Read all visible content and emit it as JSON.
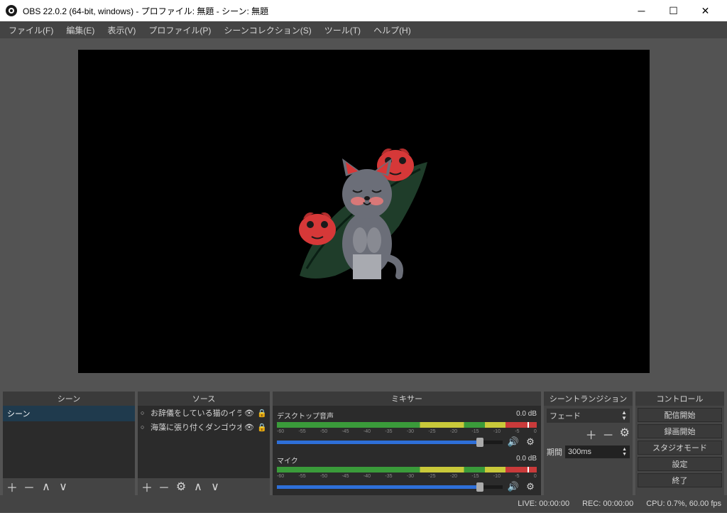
{
  "window": {
    "title": "OBS 22.0.2 (64-bit, windows) - プロファイル: 無題 - シーン: 無題"
  },
  "menu": {
    "file": "ファイル(F)",
    "edit": "編集(E)",
    "view": "表示(V)",
    "profile": "プロファイル(P)",
    "scene_collection": "シーンコレクション(S)",
    "tools": "ツール(T)",
    "help": "ヘルプ(H)"
  },
  "panels": {
    "scenes_title": "シーン",
    "sources_title": "ソース",
    "mixer_title": "ミキサー",
    "transitions_title": "シーントランジション",
    "controls_title": "コントロール"
  },
  "scenes": {
    "items": [
      "シーン"
    ]
  },
  "sources": {
    "items": [
      {
        "label": "お辞儀をしている猫のイラスト"
      },
      {
        "label": "海藻に張り付くダンゴウオのイラス"
      }
    ]
  },
  "mixer": {
    "items": [
      {
        "name": "デスクトップ音声",
        "db": "0.0 dB",
        "ticks": [
          "-60",
          "-55",
          "-50",
          "-45",
          "-40",
          "-35",
          "-30",
          "-25",
          "-20",
          "-15",
          "-10",
          "-5",
          "0"
        ],
        "slider_pct": 90
      },
      {
        "name": "マイク",
        "db": "0.0 dB",
        "ticks": [
          "-60",
          "-55",
          "-50",
          "-45",
          "-40",
          "-35",
          "-30",
          "-25",
          "-20",
          "-15",
          "-10",
          "-5",
          "0"
        ],
        "slider_pct": 90
      }
    ]
  },
  "transitions": {
    "selected": "フェード",
    "duration_label": "期間",
    "duration_value": "300ms"
  },
  "controls": {
    "start_stream": "配信開始",
    "start_record": "録画開始",
    "studio_mode": "スタジオモード",
    "settings": "設定",
    "exit": "終了"
  },
  "status": {
    "live": "LIVE: 00:00:00",
    "rec": "REC: 00:00:00",
    "cpu": "CPU: 0.7%, 60.00 fps"
  }
}
